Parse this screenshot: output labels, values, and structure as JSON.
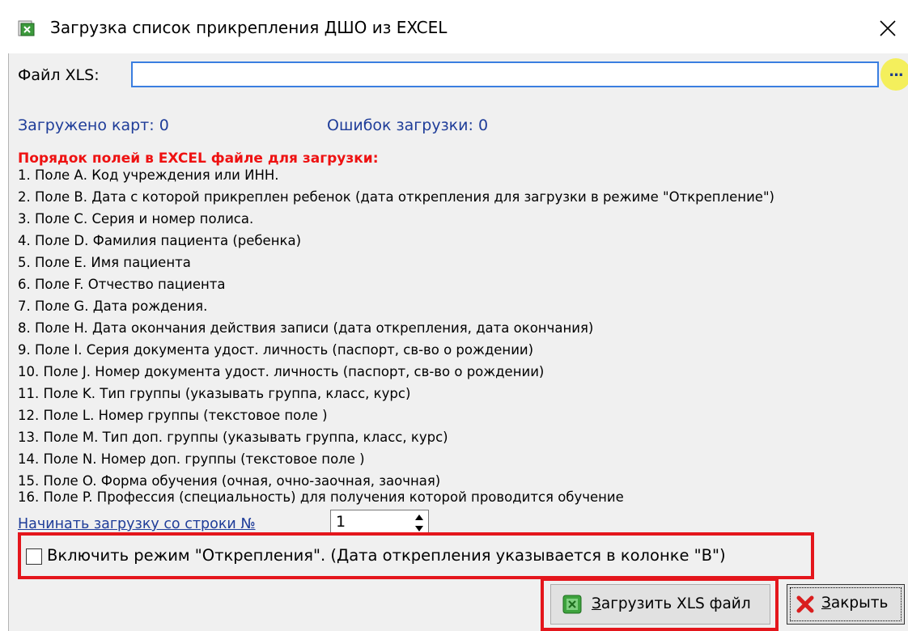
{
  "window": {
    "title": "Загрузка список прикрепления ДШО из EXCEL",
    "close_glyph": "✕"
  },
  "file": {
    "label": "Файл XLS:",
    "value": "",
    "browse_label": "..."
  },
  "stats": {
    "loaded": "Загружено карт: 0",
    "errors": "Ошибок загрузки: 0"
  },
  "fields": {
    "title": "Порядок полей в EXCEL файле для загрузки:",
    "items": [
      "1. Поле А.  Код учреждения или ИНН.",
      "2. Поле B. Дата с которой прикреплен ребенок (дата открепления для загрузки в режиме \"Открепление\")",
      "3. Поле C. Серия и номер полиса.",
      "4. Поле D. Фамилия пациента (ребенка)",
      "5. Поле E. Имя пациента",
      "6. Поле F. Отчество пациента",
      "7. Поле G. Дата рождения.",
      "8. Поле H. Дата окончания действия записи (дата открепления, дата окончания)",
      "9. Поле I. Серия документа удост. личность (паспорт, св-во о рождении)",
      "10. Поле J. Номер документа удост. личность (паспорт, св-во о рождении)",
      "11. Поле K. Тип группы (указывать группа, класс, курс)",
      "12. Поле L. Номер группы (текстовое поле )",
      "13. Поле M. Тип доп. группы (указывать группа, класс, курс)",
      "14. Поле N. Номер доп. группы (текстовое поле )",
      "15. Поле O. Форма обучения (очная, очно-заочная, заочная)",
      "16. Поле P. Профессия (специальность) для получения которой проводится обучение"
    ]
  },
  "start_row": {
    "label": "Начинать загрузку со строки №",
    "value": "1"
  },
  "detach_mode": {
    "label": "Включить режим \"Открепления\". (Дата открепления указывается в колонке \"В\")",
    "checked": false
  },
  "buttons": {
    "load": {
      "accel": "З",
      "rest": "агрузить XLS файл",
      "icon": "excel-icon"
    },
    "close": {
      "accel": "З",
      "rest": "акрыть",
      "icon": "red-x-icon"
    }
  },
  "colors": {
    "accent_blue": "#1f3d99",
    "highlight_red": "#e4161c",
    "title_red": "#ee1111",
    "browse_highlight": "#f4ef5c"
  }
}
